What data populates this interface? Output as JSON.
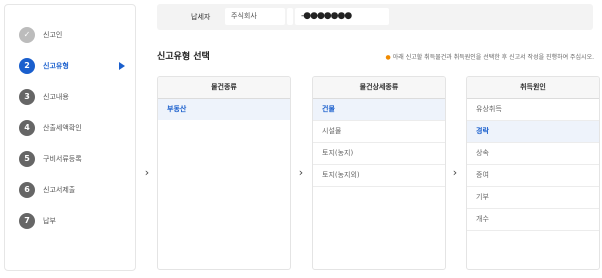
{
  "sidebar": {
    "steps": [
      {
        "num": "✓",
        "label": "신고인",
        "state": "done"
      },
      {
        "num": "2",
        "label": "신고유형",
        "state": "active"
      },
      {
        "num": "3",
        "label": "신고내용",
        "state": "pending"
      },
      {
        "num": "4",
        "label": "산출세액확인",
        "state": "pending"
      },
      {
        "num": "5",
        "label": "구비서류등록",
        "state": "pending"
      },
      {
        "num": "6",
        "label": "신고서제출",
        "state": "pending"
      },
      {
        "num": "7",
        "label": "납부",
        "state": "pending"
      }
    ]
  },
  "taxpayer": {
    "label": "납세자",
    "name": "주식회사",
    "id_masked": "-●●●●●●●"
  },
  "section": {
    "title": "신고유형 선택",
    "notice": "아래 신고할 취득물건과 취득원인을 선택한 후 신고서 작성을 진행하여 주십시오."
  },
  "panels": {
    "property_type": {
      "header": "물건종류",
      "items": [
        {
          "label": "부동산",
          "selected": true
        }
      ]
    },
    "property_detail": {
      "header": "물건상세종류",
      "items": [
        {
          "label": "건물",
          "selected": true
        },
        {
          "label": "시설물",
          "selected": false
        },
        {
          "label": "토지(농지)",
          "selected": false
        },
        {
          "label": "토지(농지외)",
          "selected": false
        }
      ]
    },
    "acquisition_cause": {
      "header": "취득원인",
      "items": [
        {
          "label": "유상취득",
          "selected": false
        },
        {
          "label": "경락",
          "selected": true
        },
        {
          "label": "상속",
          "selected": false
        },
        {
          "label": "증여",
          "selected": false
        },
        {
          "label": "기부",
          "selected": false
        },
        {
          "label": "개수",
          "selected": false
        }
      ]
    }
  },
  "chevron_glyph": "›",
  "colors": {
    "accent": "#1a5fcd",
    "notice_dot": "#f08a00"
  }
}
